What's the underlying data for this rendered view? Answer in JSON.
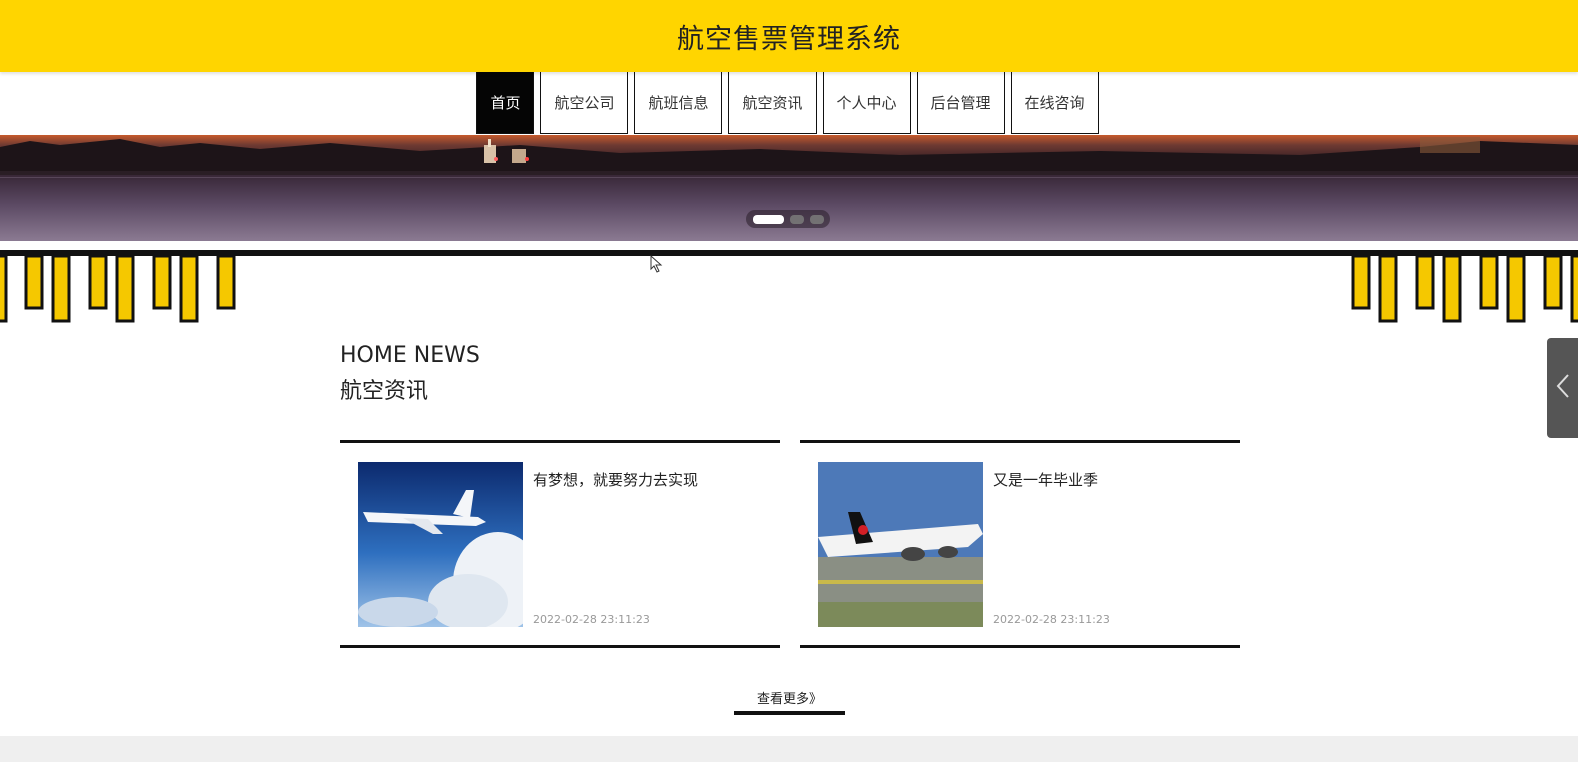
{
  "header": {
    "title": "航空售票管理系统"
  },
  "nav": {
    "items": [
      {
        "label": "首页",
        "active": true
      },
      {
        "label": "航空公司"
      },
      {
        "label": "航班信息"
      },
      {
        "label": "航空资讯"
      },
      {
        "label": "个人中心"
      },
      {
        "label": "后台管理"
      },
      {
        "label": "在线咨询"
      }
    ]
  },
  "banner": {
    "slide_count": 3,
    "active_slide": 1
  },
  "news_section": {
    "title_en": "HOME NEWS",
    "title_cn": "航空资讯",
    "items": [
      {
        "title": "有梦想，就要努力去实现",
        "date": "2022-02-28 23:11:23"
      },
      {
        "title": "又是一年毕业季",
        "date": "2022-02-28 23:11:23"
      }
    ],
    "more_label": "查看更多》"
  },
  "colors": {
    "brand_yellow": "#ffd500",
    "dark": "#111111"
  }
}
